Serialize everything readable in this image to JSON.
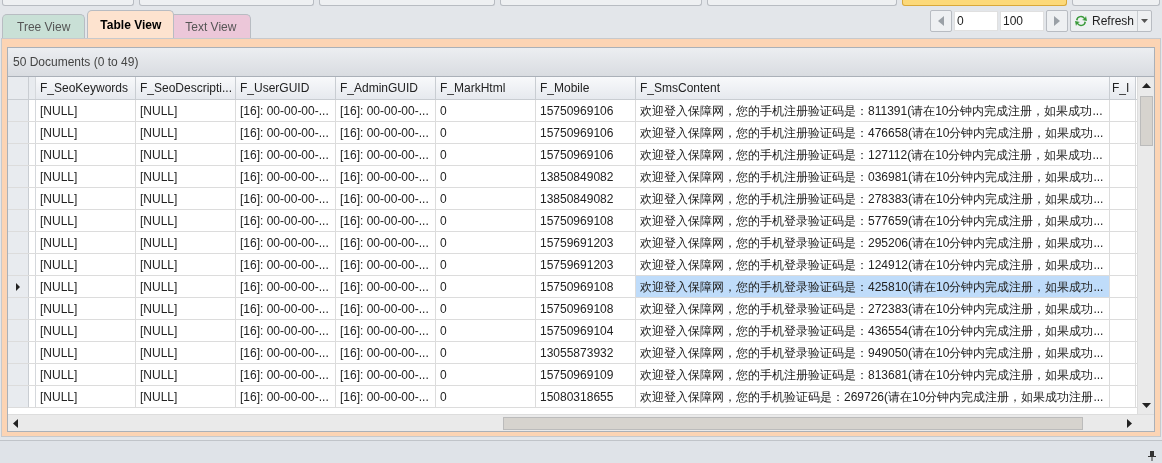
{
  "tabs": [
    {
      "label": "Tree View",
      "selected": false,
      "color": "#c9e0d6"
    },
    {
      "label": "Table View",
      "selected": true,
      "color": "#fde3cf"
    },
    {
      "label": "Text View",
      "selected": false,
      "color": "#ecc7d9"
    }
  ],
  "pager": {
    "start": "0",
    "count": "100",
    "refresh": "Refresh"
  },
  "summary": "50 Documents (0 to 49)",
  "table": {
    "columns": [
      "F_SeoKeywords",
      "F_SeoDescripti...",
      "F_UserGUID",
      "F_AdminGUID",
      "F_MarkHtml",
      "F_Mobile",
      "F_SmsContent",
      "F_I"
    ],
    "rows": [
      {
        "selected": false,
        "cells": [
          "[NULL]",
          "[NULL]",
          "[16]: 00-00-00-...",
          "[16]: 00-00-00-...",
          "0",
          "15750969106",
          "欢迎登入保障网，您的手机注册验证码是：811391(请在10分钟内完成注册，如果成功..."
        ]
      },
      {
        "selected": false,
        "cells": [
          "[NULL]",
          "[NULL]",
          "[16]: 00-00-00-...",
          "[16]: 00-00-00-...",
          "0",
          "15750969106",
          "欢迎登入保障网，您的手机注册验证码是：476658(请在10分钟内完成注册，如果成功..."
        ]
      },
      {
        "selected": false,
        "cells": [
          "[NULL]",
          "[NULL]",
          "[16]: 00-00-00-...",
          "[16]: 00-00-00-...",
          "0",
          "15750969106",
          "欢迎登入保障网，您的手机注册验证码是：127112(请在10分钟内完成注册，如果成功..."
        ]
      },
      {
        "selected": false,
        "cells": [
          "[NULL]",
          "[NULL]",
          "[16]: 00-00-00-...",
          "[16]: 00-00-00-...",
          "0",
          "13850849082",
          "欢迎登入保障网，您的手机注册验证码是：036981(请在10分钟内完成注册，如果成功..."
        ]
      },
      {
        "selected": false,
        "cells": [
          "[NULL]",
          "[NULL]",
          "[16]: 00-00-00-...",
          "[16]: 00-00-00-...",
          "0",
          "13850849082",
          "欢迎登入保障网，您的手机注册验证码是：278383(请在10分钟内完成注册，如果成功..."
        ]
      },
      {
        "selected": false,
        "cells": [
          "[NULL]",
          "[NULL]",
          "[16]: 00-00-00-...",
          "[16]: 00-00-00-...",
          "0",
          "15750969108",
          "欢迎登入保障网，您的手机登录验证码是：577659(请在10分钟内完成注册，如果成功..."
        ]
      },
      {
        "selected": false,
        "cells": [
          "[NULL]",
          "[NULL]",
          "[16]: 00-00-00-...",
          "[16]: 00-00-00-...",
          "0",
          "15759691203",
          "欢迎登入保障网，您的手机登录验证码是：295206(请在10分钟内完成注册，如果成功..."
        ]
      },
      {
        "selected": false,
        "cells": [
          "[NULL]",
          "[NULL]",
          "[16]: 00-00-00-...",
          "[16]: 00-00-00-...",
          "0",
          "15759691203",
          "欢迎登入保障网，您的手机登录验证码是：124912(请在10分钟内完成注册，如果成功..."
        ]
      },
      {
        "selected": true,
        "cells": [
          "[NULL]",
          "[NULL]",
          "[16]: 00-00-00-...",
          "[16]: 00-00-00-...",
          "0",
          "15750969108",
          "欢迎登入保障网，您的手机登录验证码是：425810(请在10分钟内完成注册，如果成功..."
        ]
      },
      {
        "selected": false,
        "cells": [
          "[NULL]",
          "[NULL]",
          "[16]: 00-00-00-...",
          "[16]: 00-00-00-...",
          "0",
          "15750969108",
          "欢迎登入保障网，您的手机登录验证码是：272383(请在10分钟内完成注册，如果成功..."
        ]
      },
      {
        "selected": false,
        "cells": [
          "[NULL]",
          "[NULL]",
          "[16]: 00-00-00-...",
          "[16]: 00-00-00-...",
          "0",
          "15750969104",
          "欢迎登入保障网，您的手机登录验证码是：436554(请在10分钟内完成注册，如果成功..."
        ]
      },
      {
        "selected": false,
        "cells": [
          "[NULL]",
          "[NULL]",
          "[16]: 00-00-00-...",
          "[16]: 00-00-00-...",
          "0",
          "13055873932",
          "欢迎登入保障网，您的手机登录验证码是：949050(请在10分钟内完成注册，如果成功..."
        ]
      },
      {
        "selected": false,
        "cells": [
          "[NULL]",
          "[NULL]",
          "[16]: 00-00-00-...",
          "[16]: 00-00-00-...",
          "0",
          "15750969109",
          "欢迎登入保障网，您的手机注册验证码是：813681(请在10分钟内完成注册，如果成功..."
        ]
      },
      {
        "selected": false,
        "cells": [
          "[NULL]",
          "[NULL]",
          "[16]: 00-00-00-...",
          "[16]: 00-00-00-...",
          "0",
          "15080318655",
          "欢迎登入保障网，您的手机验证码是：269726(请在10分钟内完成注册，如果成功注册..."
        ]
      }
    ]
  }
}
